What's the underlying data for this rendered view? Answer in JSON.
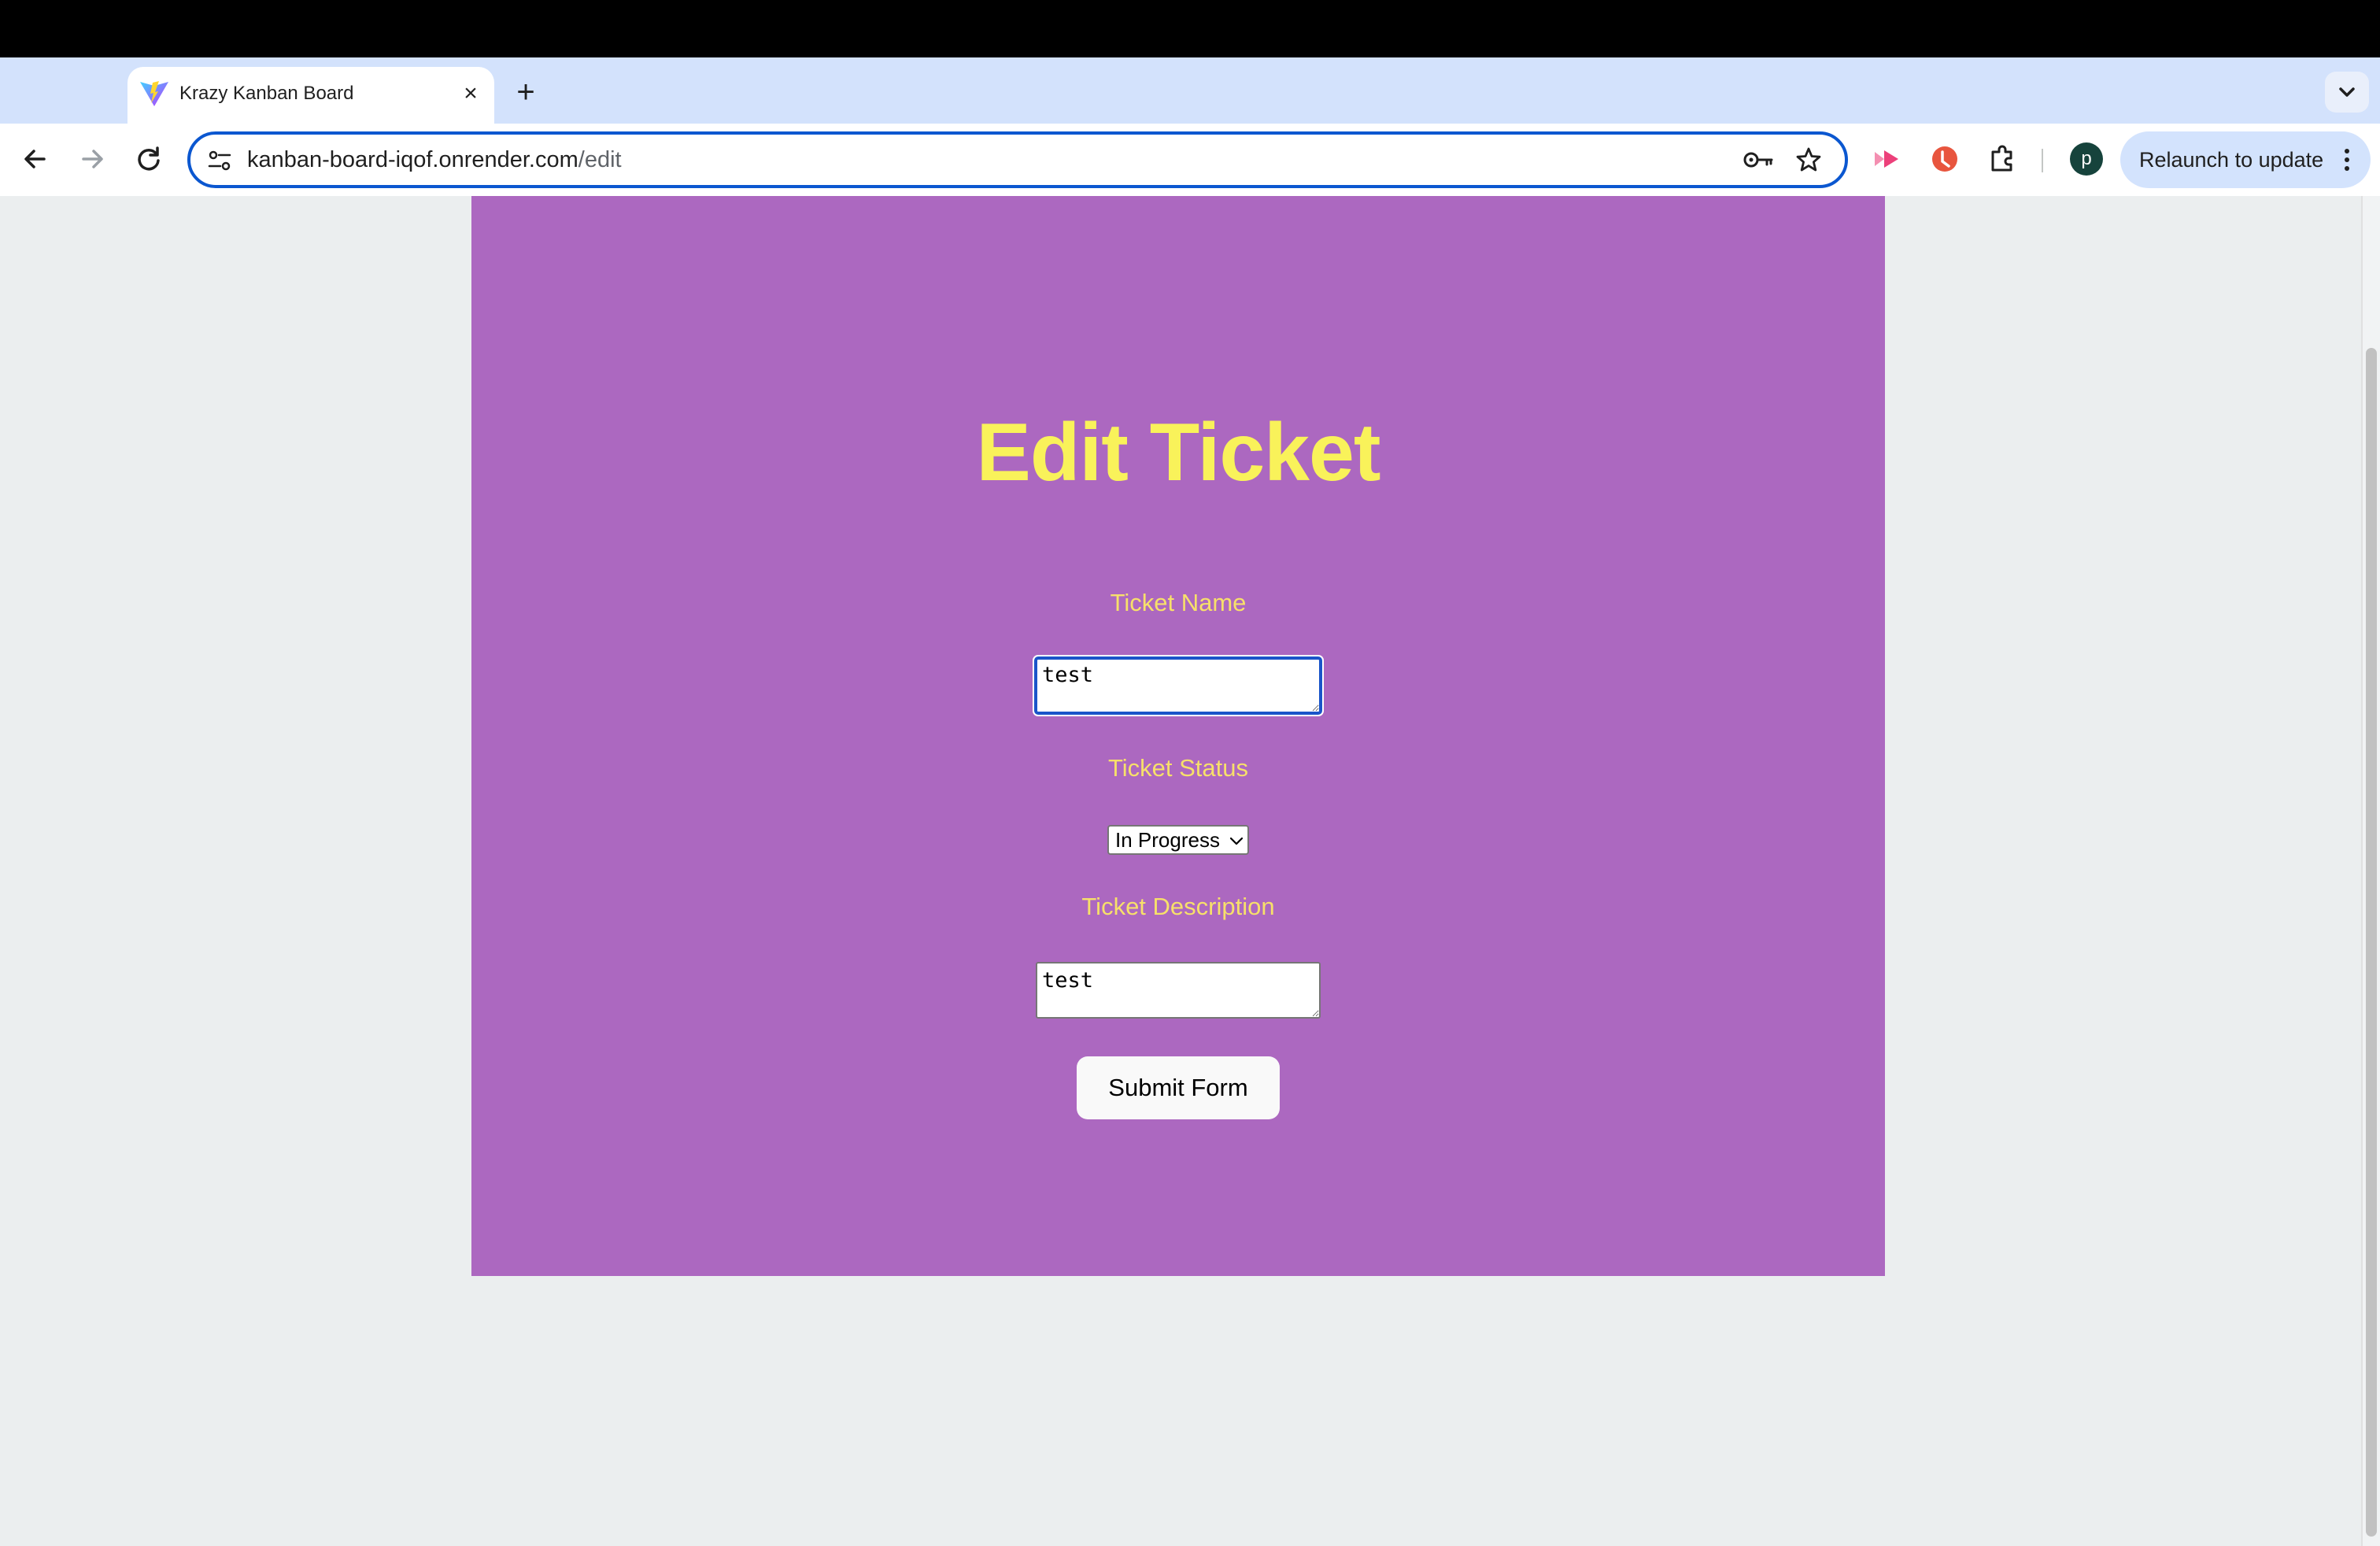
{
  "browser": {
    "tab": {
      "title": "Krazy Kanban Board"
    },
    "omnibox": {
      "url_host": "kanban-board-iqof.onrender.com",
      "url_path": "/edit"
    },
    "profile_initial": "p",
    "relaunch_label": "Relaunch to update"
  },
  "page": {
    "title": "Edit Ticket",
    "form": {
      "name_label": "Ticket Name",
      "name_value": "test",
      "status_label": "Ticket Status",
      "status_value": "In Progress",
      "description_label": "Ticket Description",
      "description_value": "test",
      "submit_label": "Submit Form"
    }
  },
  "colors": {
    "card_background": "#ac68c0",
    "title": "#f9f25a",
    "labels": "#f7e06a",
    "page_background": "#ebeeef"
  }
}
